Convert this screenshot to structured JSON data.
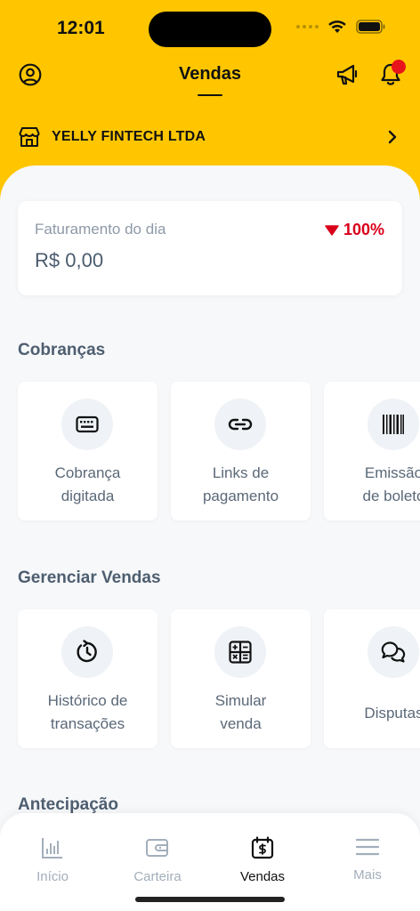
{
  "status": {
    "time": "12:01"
  },
  "header": {
    "title": "Vendas"
  },
  "company": {
    "name": "YELLY FINTECH LTDA"
  },
  "revenue": {
    "label": "Faturamento do dia",
    "value": "R$ 0,00",
    "change": "100%",
    "change_color": "#D9001B"
  },
  "sections": {
    "cobrancas": {
      "title": "Cobranças",
      "cards": [
        {
          "label": "Cobrança\ndigitada",
          "icon": "keyboard-icon"
        },
        {
          "label": "Links de\npagamento",
          "icon": "link-icon"
        },
        {
          "label": "Emissão\nde boleto",
          "icon": "barcode-icon"
        }
      ]
    },
    "gerenciar": {
      "title": "Gerenciar Vendas",
      "cards": [
        {
          "label": "Histórico de\ntransações",
          "icon": "history-icon"
        },
        {
          "label": "Simular\nvenda",
          "icon": "calculator-icon"
        },
        {
          "label": "Disputas",
          "icon": "chat-icon"
        }
      ]
    },
    "antecipacao": {
      "title": "Antecipação"
    }
  },
  "bottom_nav": [
    {
      "label": "Início",
      "icon": "bar-chart-icon",
      "active": false
    },
    {
      "label": "Carteira",
      "icon": "wallet-icon",
      "active": false
    },
    {
      "label": "Vendas",
      "icon": "calendar-dollar-icon",
      "active": true
    },
    {
      "label": "Mais",
      "icon": "menu-icon",
      "active": false
    }
  ],
  "colors": {
    "brand": "#FFC600",
    "notification": "#E8141B",
    "text_dark": "#111111",
    "text_muted": "#8E99A7"
  }
}
